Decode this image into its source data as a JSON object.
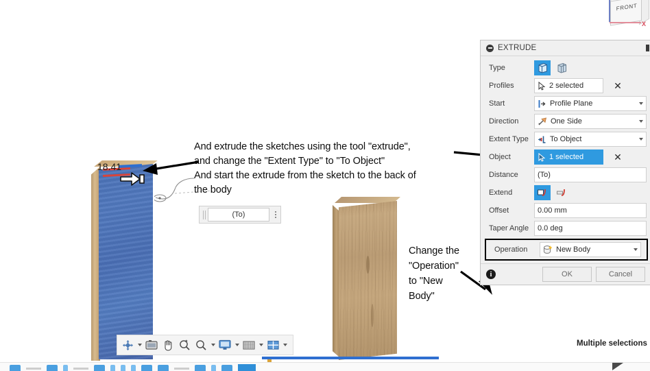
{
  "app": {
    "viewcube_label": "FRONT",
    "axis_label": "X"
  },
  "canvas": {
    "dimension_value": "18.41",
    "manipulator_field": {
      "value": "(To)"
    }
  },
  "annotations": [
    {
      "id": "extrude-instruction",
      "lines": [
        "And extrude the sketches using the tool \"extrude\",",
        "and change the \"Extent Type\" to \"To Object\"",
        "And start the extrude from the sketch to the back of",
        "the body"
      ]
    },
    {
      "id": "operation-instruction",
      "lines": [
        "Change the",
        "\"Operation\"",
        "to \"New",
        "Body\""
      ]
    }
  ],
  "nav_toolbar": {
    "tools": [
      {
        "name": "orbit-icon",
        "label": "Orbit",
        "has_caret": true
      },
      {
        "name": "display-settings-icon",
        "label": "Display Settings",
        "has_caret": false
      },
      {
        "name": "pan-icon",
        "label": "Pan",
        "has_caret": false
      },
      {
        "name": "zoom-window-icon",
        "label": "Zoom Window",
        "has_caret": false
      },
      {
        "name": "zoom-icon",
        "label": "Zoom",
        "has_caret": true
      },
      {
        "name": "screen-icon",
        "label": "Display Settings",
        "has_caret": true
      },
      {
        "name": "grid-icon",
        "label": "Grid and Snaps",
        "has_caret": true
      },
      {
        "name": "viewports-icon",
        "label": "Viewports",
        "has_caret": true
      }
    ]
  },
  "dialog": {
    "title": "EXTRUDE",
    "rows": {
      "type": {
        "label": "Type",
        "options": [
          {
            "name": "extrude-profile-icon",
            "selected": true
          },
          {
            "name": "extrude-edge-icon",
            "selected": false
          }
        ]
      },
      "profiles": {
        "label": "Profiles",
        "value": "2 selected",
        "active": false
      },
      "start": {
        "label": "Start",
        "value": "Profile Plane"
      },
      "direction": {
        "label": "Direction",
        "value": "One Side"
      },
      "extent_type": {
        "label": "Extent Type",
        "value": "To Object"
      },
      "object": {
        "label": "Object",
        "value": "1 selected",
        "active": true
      },
      "distance": {
        "label": "Distance",
        "value": "(To)"
      },
      "extend": {
        "label": "Extend",
        "options": [
          {
            "name": "extend-adjacent-faces-icon",
            "selected": true
          },
          {
            "name": "extend-no-faces-icon",
            "selected": false
          }
        ]
      },
      "offset": {
        "label": "Offset",
        "value": "0.00 mm"
      },
      "taper_angle": {
        "label": "Taper Angle",
        "value": "0.0 deg"
      },
      "operation": {
        "label": "Operation",
        "value": "New Body",
        "highlighted": true
      }
    },
    "footer": {
      "ok_label": "OK",
      "cancel_label": "Cancel"
    }
  },
  "status": {
    "hint": "Multiple selections"
  },
  "colors": {
    "accent_blue": "#2f9ae0",
    "panel_bg": "#f0f0f0",
    "body_blue": "#4e74ba",
    "body_wood": "#bd9f78",
    "highlight_red": "#d9443a"
  }
}
